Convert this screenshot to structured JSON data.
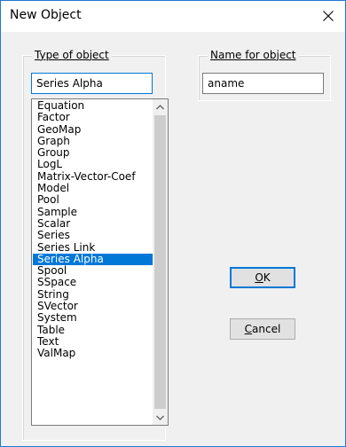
{
  "window": {
    "title": "New Object",
    "close_icon": "close-icon"
  },
  "type_group": {
    "legend": "Type of object",
    "selected_value": "Series Alpha",
    "items": [
      "Equation",
      "Factor",
      "GeoMap",
      "Graph",
      "Group",
      "LogL",
      "Matrix-Vector-Coef",
      "Model",
      "Pool",
      "Sample",
      "Scalar",
      "Series",
      "Series Link",
      "Series Alpha",
      "Spool",
      "SSpace",
      "String",
      "SVector",
      "System",
      "Table",
      "Text",
      "ValMap"
    ],
    "selected_item": "Series Alpha"
  },
  "name_group": {
    "legend": "Name for object",
    "value": "aname"
  },
  "buttons": {
    "ok": {
      "accel": "O",
      "rest": "K"
    },
    "cancel": {
      "accel": "C",
      "rest": "ancel"
    }
  },
  "colors": {
    "selection": "#0078d7",
    "dialog_bg": "#f0f0f0",
    "border_accent": "#1f78d1"
  }
}
